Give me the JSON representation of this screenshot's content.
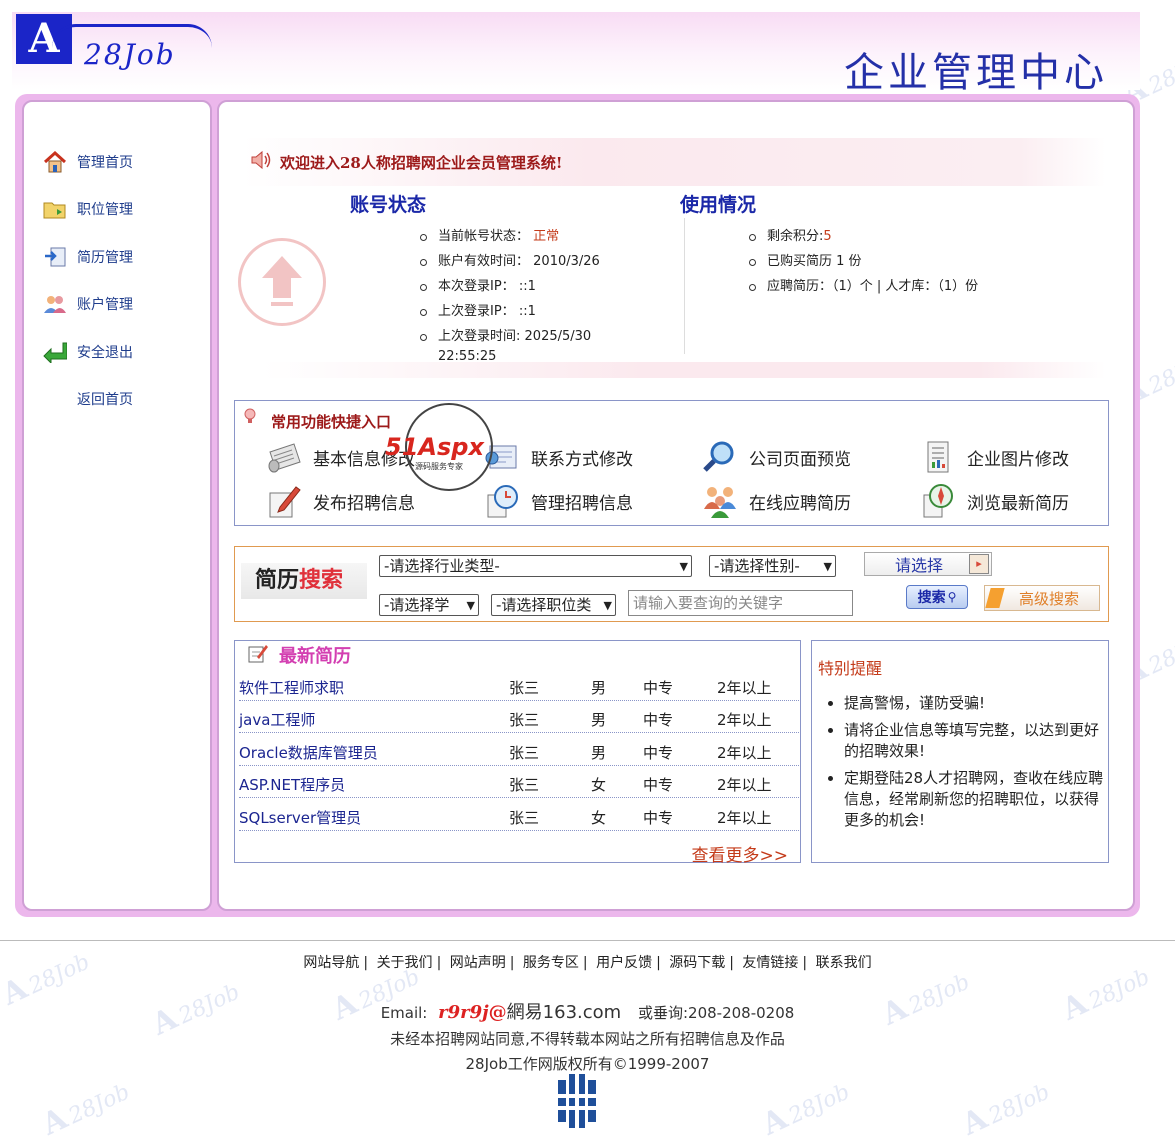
{
  "header": {
    "logo_text": "28Job",
    "title": "企业管理中心"
  },
  "sidebar": {
    "items": [
      {
        "label": "管理首页",
        "icon": "home-icon"
      },
      {
        "label": "职位管理",
        "icon": "folder-icon"
      },
      {
        "label": "简历管理",
        "icon": "resume-icon"
      },
      {
        "label": "账户管理",
        "icon": "users-icon"
      },
      {
        "label": "安全退出",
        "icon": "exit-arrow-icon"
      },
      {
        "label": "返回首页",
        "icon": ""
      }
    ]
  },
  "welcome": {
    "text": "欢迎进入28人称招聘网企业会员管理系统!"
  },
  "account": {
    "title": "账号状态",
    "status_label": "当前帐号状态：",
    "status_value": "正常",
    "valid_label": "账户有效时间：",
    "valid_value": "2010/3/26",
    "this_ip_label": "本次登录IP：",
    "this_ip_value": "::1",
    "last_ip_label": "上次登录IP：",
    "last_ip_value": "::1",
    "last_time_label": "上次登录时间:",
    "last_time_value": "2025/5/30",
    "last_time_value2": "22:55:25"
  },
  "usage": {
    "title": "使用情况",
    "points_label": "剩余积分:",
    "points_value": "5",
    "bought": "已购买简历 1 份",
    "applied": "应聘简历：（1）个 | 人才库：（1）份"
  },
  "quick": {
    "title": "常用功能快捷入口",
    "items": [
      {
        "label": "基本信息修改",
        "icon": "newspaper-icon"
      },
      {
        "label": "联系方式修改",
        "icon": "contact-card-icon"
      },
      {
        "label": "公司页面预览",
        "icon": "magnifier-icon"
      },
      {
        "label": "企业图片修改",
        "icon": "document-icon"
      },
      {
        "label": "发布招聘信息",
        "icon": "edit-pen-icon"
      },
      {
        "label": "管理招聘信息",
        "icon": "clock-doc-icon"
      },
      {
        "label": "在线应聘简历",
        "icon": "people-group-icon"
      },
      {
        "label": "浏览最新简历",
        "icon": "compass-doc-icon"
      }
    ],
    "watermark": "51Aspx",
    "watermark_sub": "源码服务专家"
  },
  "search": {
    "title_black": "简历",
    "title_red": "搜索",
    "industry": "-请选择行业类型-",
    "gender": "-请选择性别-",
    "choose": "请选择",
    "edu": "-请选择学",
    "position": "-请选择职位类",
    "keyword_placeholder": "请输入要查询的关键字",
    "search_btn": "搜索",
    "advanced_btn": "高级搜索"
  },
  "resumes": {
    "title": "最新简历",
    "rows": [
      {
        "title": "软件工程师求职",
        "name": "张三",
        "gender": "男",
        "edu": "中专",
        "exp": "2年以上"
      },
      {
        "title": "java工程师",
        "name": "张三",
        "gender": "男",
        "edu": "中专",
        "exp": "2年以上"
      },
      {
        "title": "Oracle数据库管理员",
        "name": "张三",
        "gender": "男",
        "edu": "中专",
        "exp": "2年以上"
      },
      {
        "title": "ASP.NET程序员",
        "name": "张三",
        "gender": "女",
        "edu": "中专",
        "exp": "2年以上"
      },
      {
        "title": "SQLserver管理员",
        "name": "张三",
        "gender": "女",
        "edu": "中专",
        "exp": "2年以上"
      }
    ],
    "more": "查看更多>>"
  },
  "notice": {
    "title": "特别提醒",
    "items": [
      "提高警惕，谨防受骗!",
      "请将企业信息等填写完整，以达到更好的招聘效果!",
      "定期登陆28人才招聘网，查收在线应聘信息，经常刷新您的招聘职位，以获得更多的机会!"
    ]
  },
  "footer": {
    "links": [
      "网站导航",
      "关于我们",
      "网站声明",
      "服务专区",
      "用户反馈",
      "源码下载",
      "友情链接",
      "联系我们"
    ],
    "email_label": "Email:",
    "email_user": "r9r9j",
    "email_at": "@",
    "email_domain": "網易163.com",
    "phone": "或垂询:208-208-0208",
    "notice": "未经本招聘网站同意,不得转载本网站之所有招聘信息及作品",
    "copyright": "28Job工作网版权所有©1999-2007"
  }
}
